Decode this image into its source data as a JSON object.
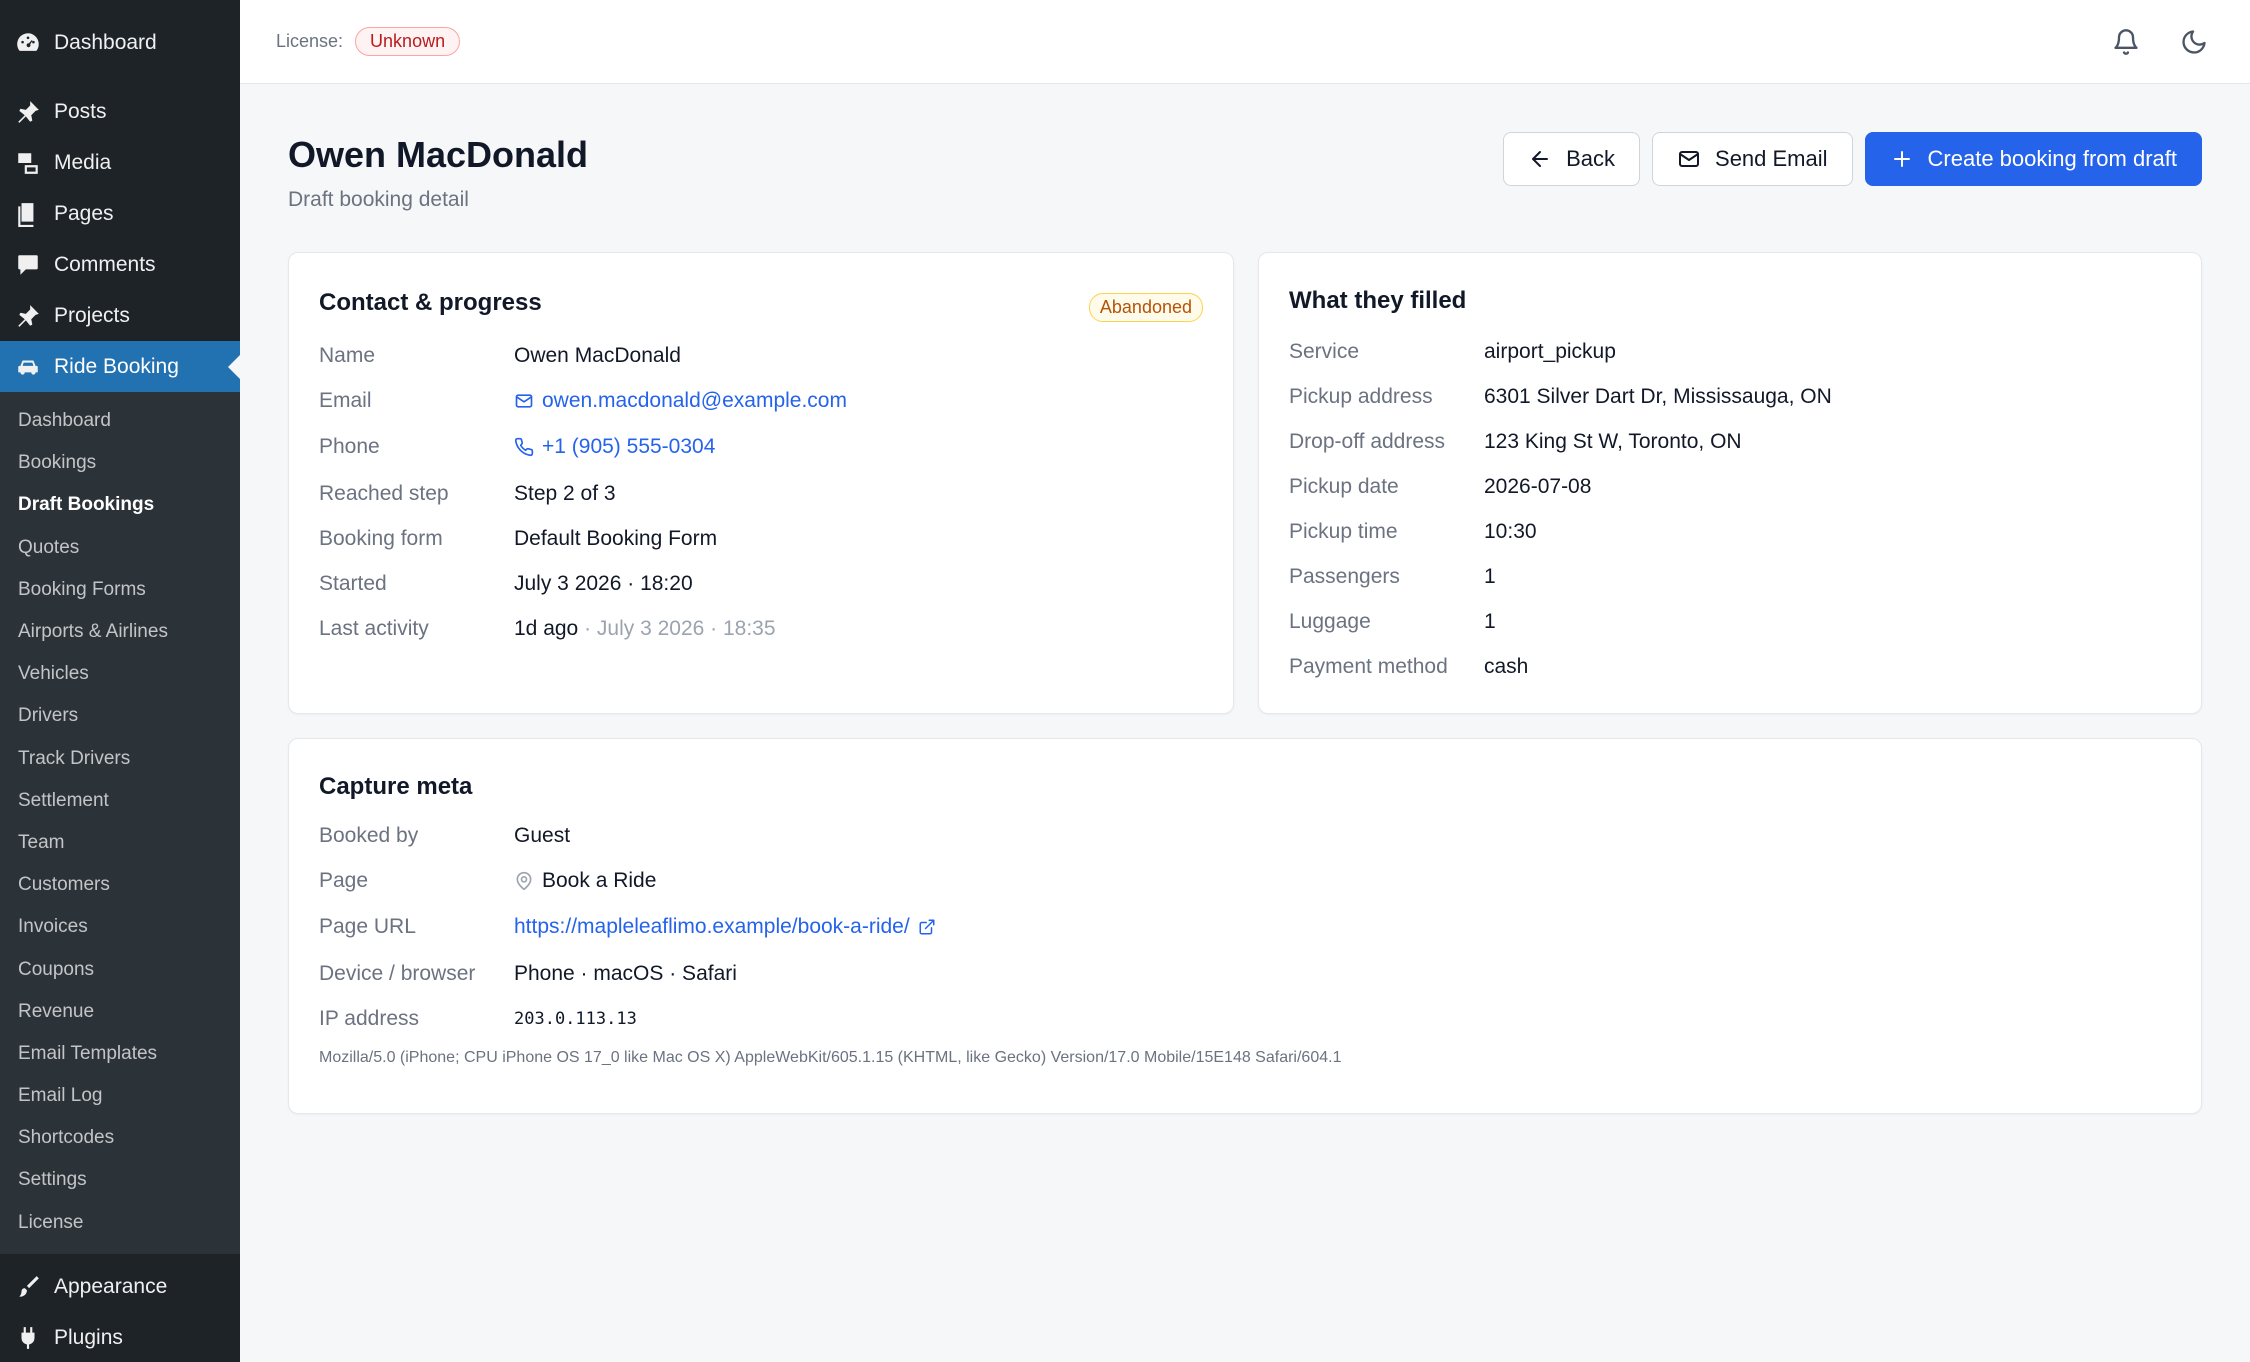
{
  "sidebar": {
    "top": [
      {
        "label": "Dashboard",
        "icon": "dashboard-icon"
      },
      {
        "label": "Posts",
        "icon": "pin-icon"
      },
      {
        "label": "Media",
        "icon": "media-icon"
      },
      {
        "label": "Pages",
        "icon": "pages-icon"
      },
      {
        "label": "Comments",
        "icon": "comments-icon"
      },
      {
        "label": "Projects",
        "icon": "pin-icon"
      },
      {
        "label": "Ride Booking",
        "icon": "car-icon"
      }
    ],
    "submenu": [
      "Dashboard",
      "Bookings",
      "Draft Bookings",
      "Quotes",
      "Booking Forms",
      "Airports & Airlines",
      "Vehicles",
      "Drivers",
      "Track Drivers",
      "Settlement",
      "Team",
      "Customers",
      "Invoices",
      "Coupons",
      "Revenue",
      "Email Templates",
      "Email Log",
      "Shortcodes",
      "Settings",
      "License"
    ],
    "current_submenu": "Draft Bookings",
    "bottom": [
      {
        "label": "Appearance",
        "icon": "brush-icon"
      },
      {
        "label": "Plugins",
        "icon": "plug-icon"
      }
    ]
  },
  "header": {
    "license_label": "License:",
    "license_status": "Unknown"
  },
  "page": {
    "title": "Owen MacDonald",
    "subtitle": "Draft booking detail",
    "back_label": "Back",
    "send_email_label": "Send Email",
    "create_label": "Create booking from draft"
  },
  "contact": {
    "title": "Contact & progress",
    "status": "Abandoned",
    "name_label": "Name",
    "name": "Owen MacDonald",
    "email_label": "Email",
    "email": "owen.macdonald@example.com",
    "phone_label": "Phone",
    "phone": "+1 (905) 555-0304",
    "step_label": "Reached step",
    "step": "Step 2 of 3",
    "form_label": "Booking form",
    "form": "Default Booking Form",
    "started_label": "Started",
    "started": "July 3 2026 · 18:20",
    "last_label": "Last activity",
    "last_rel": "1d ago",
    "last_abs": "· July 3 2026 · 18:35"
  },
  "filled": {
    "title": "What they filled",
    "rows": [
      {
        "k": "Service",
        "v": "airport_pickup"
      },
      {
        "k": "Pickup address",
        "v": "6301 Silver Dart Dr, Mississauga, ON"
      },
      {
        "k": "Drop-off address",
        "v": "123 King St W, Toronto, ON"
      },
      {
        "k": "Pickup date",
        "v": "2026-07-08"
      },
      {
        "k": "Pickup time",
        "v": "10:30"
      },
      {
        "k": "Passengers",
        "v": "1"
      },
      {
        "k": "Luggage",
        "v": "1"
      },
      {
        "k": "Payment method",
        "v": "cash"
      }
    ]
  },
  "meta": {
    "title": "Capture meta",
    "booked_by_label": "Booked by",
    "booked_by": "Guest",
    "page_label": "Page",
    "page": "Book a Ride",
    "url_label": "Page URL",
    "url": "https://mapleleaflimo.example/book-a-ride/",
    "device_label": "Device / browser",
    "device": "Phone · macOS · Safari",
    "ip_label": "IP address",
    "ip": "203.0.113.13",
    "user_agent": "Mozilla/5.0 (iPhone; CPU iPhone OS 17_0 like Mac OS X) AppleWebKit/605.1.15 (KHTML, like Gecko) Version/17.0 Mobile/15E148 Safari/604.1"
  }
}
